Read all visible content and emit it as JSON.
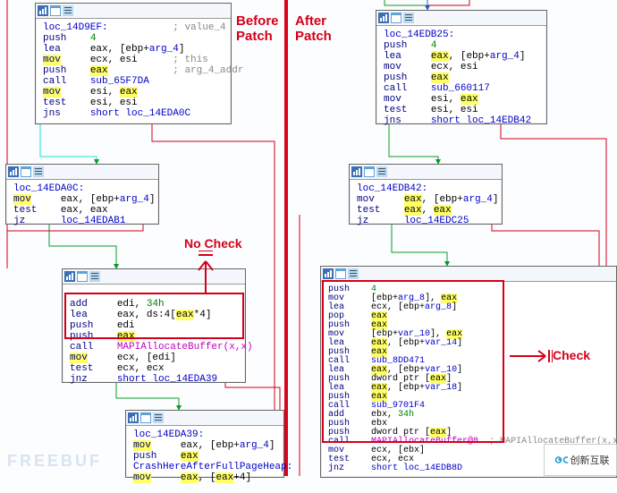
{
  "labels": {
    "before": "Before\nPatch",
    "after": "After\nPatch",
    "nocheck": "No Check",
    "check": "Check"
  },
  "icons": {
    "chart": "chart-icon",
    "win": "window-icon",
    "doc": "doc-icon"
  },
  "box1": {
    "loc": "loc_14D9EF:",
    "cmt": "; value_4",
    "l1a": "push",
    "l1b": "4",
    "l2a": "lea",
    "l2b": "eax, [ebp+",
    "l2c": "arg_4",
    "l2d": "]",
    "l3a": "mov",
    "l3b": "ecx, esi",
    "l3c": "; this",
    "l4a": "push",
    "l4b": "eax",
    "l4c": "; arg_4_addr",
    "l5a": "call",
    "l5b": "sub_65F7DA",
    "l6a": "mov",
    "l6b": "esi, ",
    "l6c": "eax",
    "l7a": "test",
    "l7b": "esi, esi",
    "l8a": "jns",
    "l8b": "short loc_14EDA0C"
  },
  "box2": {
    "loc": "loc_14EDA0C:",
    "l1a": "mov",
    "l1b": "eax, [ebp+",
    "l1c": "arg_4",
    "l1d": "]",
    "l2a": "test",
    "l2b": "eax, eax",
    "l3a": "jz",
    "l3b": "loc_14EDAB1"
  },
  "box3": {
    "l1a": "add",
    "l1b": "edi, ",
    "l1c": "34h",
    "l2a": "lea",
    "l2b": "eax, ds:4[",
    "l2c": "eax",
    "l2d": "*4]",
    "l3a": "push",
    "l3b": "edi",
    "l4a": "push",
    "l4b": "eax",
    "l5a": "call",
    "l5b": "MAPIAllocateBuffer(x,x)",
    "l6a": "mov",
    "l6b": "ecx, [edi]",
    "l7a": "test",
    "l7b": "ecx, ecx",
    "l8a": "jnz",
    "l8b": "short loc_14EDA39"
  },
  "box4": {
    "loc": "loc_14EDA39:",
    "l1a": "mov",
    "l1b": "eax, [ebp+",
    "l1c": "arg_4",
    "l1d": "]",
    "l2a": "push",
    "l2b": "eax",
    "l3a": "CrashHereAfterFullPageHeap:",
    "l4a": "mov",
    "l4b": "eax",
    "l4c": ", [",
    "l4d": "eax",
    "l4e": "+4]"
  },
  "box5": {
    "loc": "loc_14EDB25:",
    "l1a": "push",
    "l1b": "4",
    "l2a": "lea",
    "l2b": "eax",
    "l2c": ", [ebp+",
    "l2d": "arg_4",
    "l2e": "]",
    "l3a": "mov",
    "l3b": "ecx, esi",
    "l4a": "push",
    "l4b": "eax",
    "l5a": "call",
    "l5b": "sub_660117",
    "l6a": "mov",
    "l6b": "esi, ",
    "l6c": "eax",
    "l7a": "test",
    "l7b": "esi, esi",
    "l8a": "jns",
    "l8b": "short loc_14EDB42"
  },
  "box6": {
    "loc": "loc_14EDB42:",
    "l1a": "mov",
    "l1b": "eax",
    "l1c": ", [ebp+",
    "l1d": "arg_4",
    "l1e": "]",
    "l2a": "test",
    "l2b": "eax",
    "l2c": ", ",
    "l2d": "eax",
    "l3a": "jz",
    "l3b": "loc_14EDC25"
  },
  "box7": {
    "l1a": "push",
    "l1b": "4",
    "l2a": "mov",
    "l2b": "[ebp+",
    "l2c": "arg_8",
    "l2d": "], ",
    "l2e": "eax",
    "l3a": "lea",
    "l3b": "ecx, [ebp+",
    "l3c": "arg_8",
    "l3d": "]",
    "l4a": "pop",
    "l4b": "eax",
    "l5a": "push",
    "l5b": "eax",
    "l6a": "mov",
    "l6b": "[ebp+",
    "l6c": "var_10",
    "l6d": "], ",
    "l6e": "eax",
    "l7a": "lea",
    "l7b": "eax",
    "l7c": ", [ebp+",
    "l7d": "var_14",
    "l7e": "]",
    "l8a": "push",
    "l8b": "eax",
    "l9a": "call",
    "l9b": "sub_8DD471",
    "l10a": "lea",
    "l10b": "eax",
    "l10c": ", [ebp+",
    "l10d": "var_10",
    "l10e": "]",
    "l11a": "push",
    "l11b": "dword ptr [",
    "l11c": "eax",
    "l11d": "]",
    "l12a": "lea",
    "l12b": "eax",
    "l12c": ", [ebp+",
    "l12d": "var_18",
    "l12e": "]",
    "l13a": "push",
    "l13b": "eax",
    "l14a": "call",
    "l14b": "sub_9701F4",
    "l15a": "add",
    "l15b": "ebx, ",
    "l15c": "34h",
    "l16a": "push",
    "l16b": "ebx",
    "l17a": "push",
    "l17b": "dword ptr [",
    "l17c": "eax",
    "l17d": "]",
    "l18a": "call",
    "l18b": "MAPIAllocateBuffer@8",
    "l18c": "; MAPIAllocateBuffer(x,x)",
    "l19a": "mov",
    "l19b": "ecx, [ebx]",
    "l20a": "test",
    "l20b": "ecx, ecx",
    "l21a": "jnz",
    "l21b": "short loc_14EDB8D"
  },
  "watermark": "FREEBUF",
  "logo": "创新互联"
}
